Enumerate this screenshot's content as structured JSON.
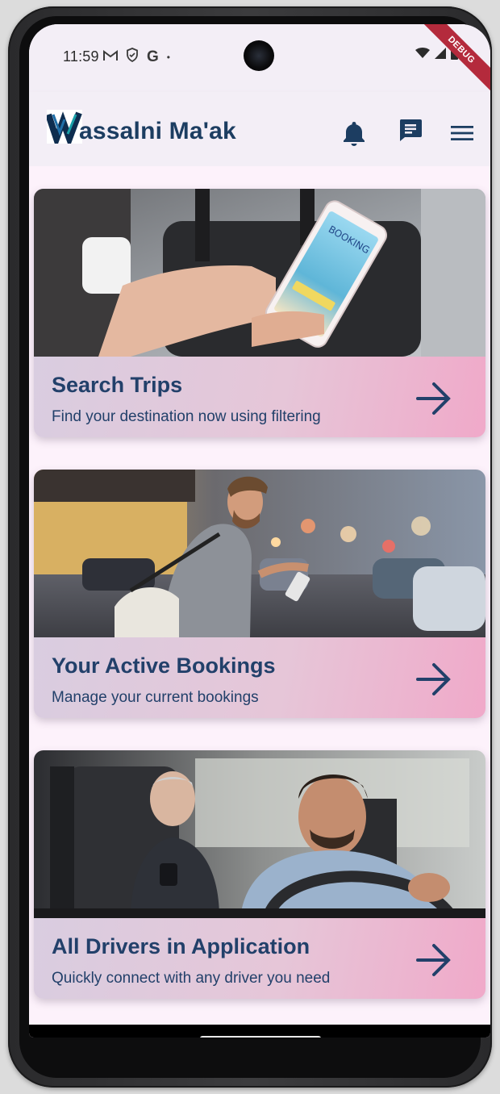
{
  "status_bar": {
    "time": "11:59",
    "icons": [
      "gmail-icon",
      "shield-icon",
      "google-icon",
      "dot-icon"
    ],
    "g_label": "G",
    "debug_label": "DEBUG"
  },
  "app_bar": {
    "logo_letter": "W",
    "title_rest": "assalni Ma'ak",
    "accent_color": "#1c3d61"
  },
  "cards": [
    {
      "title": "Search Trips",
      "subtitle": "Find your destination now using filtering",
      "image": "booking-phone-image",
      "booking_text": "BOOKING"
    },
    {
      "title": "Your Active Bookings",
      "subtitle": "Manage your current bookings",
      "image": "man-with-phone-street-image"
    },
    {
      "title": "All Drivers in Application",
      "subtitle": "Quickly connect with any driver you need",
      "image": "driver-in-car-image"
    }
  ]
}
